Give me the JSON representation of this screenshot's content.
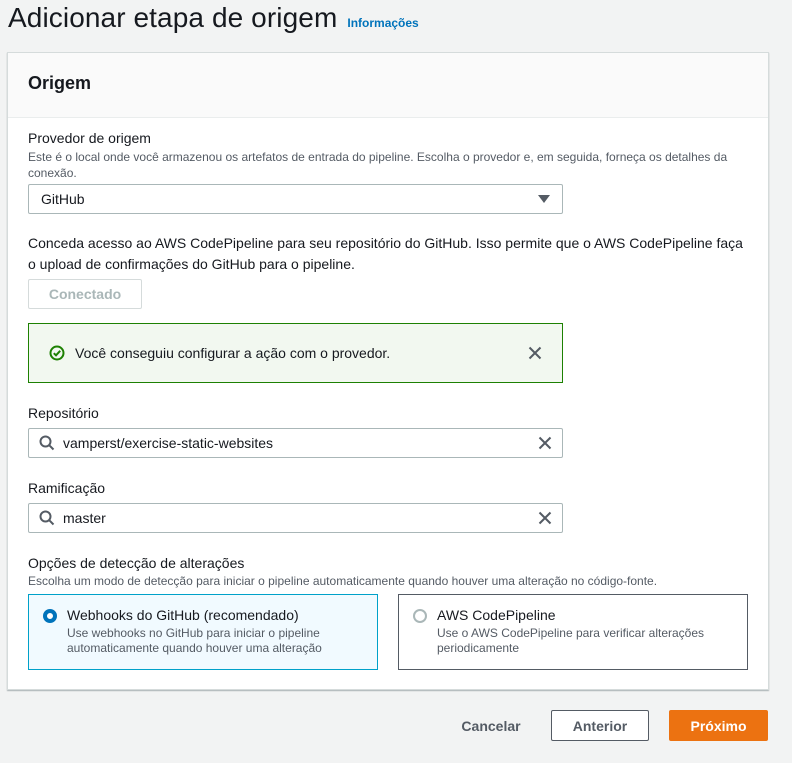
{
  "header": {
    "title": "Adicionar etapa de origem",
    "info_link": "Informações"
  },
  "section": {
    "title": "Origem"
  },
  "source_provider": {
    "label": "Provedor de origem",
    "description_line1": "Este é o local onde você armazenou os artefatos de entrada do pipeline. Escolha o provedor e, em seguida, forneça os detalhes da",
    "description_line2": "conexão.",
    "selected": "GitHub"
  },
  "grant_access": {
    "text_line1": "Conceda acesso ao AWS CodePipeline para seu repositório do GitHub. Isso permite que o AWS CodePipeline faça",
    "text_line2": "o upload de confirmações do GitHub para o pipeline.",
    "connected_button": "Conectado"
  },
  "alert": {
    "message": "Você conseguiu configurar a ação com o provedor.",
    "status_color": "#1d8102"
  },
  "repository": {
    "label": "Repositório",
    "value": "vamperst/exercise-static-websites"
  },
  "branch": {
    "label": "Ramificação",
    "value": "master"
  },
  "change_detection": {
    "label": "Opções de detecção de alterações",
    "description": "Escolha um modo de detecção para iniciar o pipeline automaticamente quando houver uma alteração no código-fonte.",
    "options": [
      {
        "title": "Webhooks do GitHub (recomendado)",
        "desc_line1": "Use webhooks no GitHub para iniciar o pipeline",
        "desc_line2": "automaticamente quando houver uma alteração",
        "selected": true
      },
      {
        "title": "AWS CodePipeline",
        "desc_line1": "Use o AWS CodePipeline para verificar alterações",
        "desc_line2": "periodicamente",
        "selected": false
      }
    ]
  },
  "footer": {
    "cancel": "Cancelar",
    "previous": "Anterior",
    "next": "Próximo",
    "accent_color": "#ec7211"
  }
}
